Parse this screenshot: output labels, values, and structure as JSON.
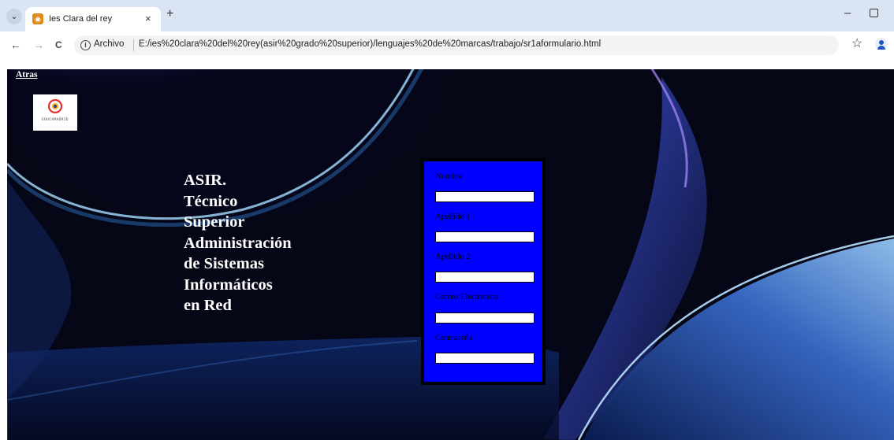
{
  "browser": {
    "tab_title": "Ies Clara del rey",
    "tab_close": "×",
    "new_tab": "+",
    "tab_search": "⌄",
    "minimize": "–",
    "scheme_label": "Archivo",
    "url": "E:/ies%20clara%20del%20rey(asir%20grado%20superior)/lenguajes%20de%20marcas/trabajo/sr1aformulario.html",
    "back": "←",
    "forward": "→",
    "reload": "C",
    "bookmark": "☆"
  },
  "page": {
    "back_link": "Atras",
    "logo_text": "EDUCAMADRID",
    "heading_lines": [
      "ASIR.",
      "Técnico",
      "Superior",
      "Administración",
      "de Sistemas",
      "Informáticos",
      "en Red"
    ],
    "form": {
      "background_color": "#0000ff",
      "fields": [
        {
          "label": "Nombre",
          "value": ""
        },
        {
          "label": "Apellido 1",
          "value": ""
        },
        {
          "label": "Apellido 2",
          "value": ""
        },
        {
          "label": "Correo Electronico",
          "value": ""
        },
        {
          "label": "Contraseña",
          "value": ""
        }
      ]
    }
  }
}
